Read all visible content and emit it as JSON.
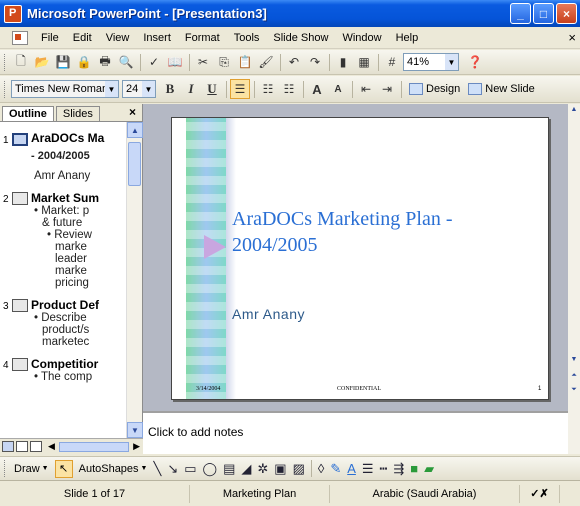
{
  "window": {
    "title": "Microsoft PowerPoint - [Presentation3]",
    "buttons": [
      "_",
      "□",
      "×"
    ]
  },
  "menu": {
    "items": [
      "File",
      "Edit",
      "View",
      "Insert",
      "Format",
      "Tools",
      "Slide Show",
      "Window",
      "Help"
    ],
    "close": "×"
  },
  "toolbar_standard": {
    "zoom": "41%"
  },
  "toolbar_formatting": {
    "font": "Times New Roman",
    "size": "24",
    "bold": "B",
    "italic": "I",
    "underline": "U",
    "grow_font": "A",
    "shrink_font": "A",
    "design": "Design",
    "new_slide": "New Slide"
  },
  "outline_pane": {
    "tabs": [
      "Outline",
      "Slides"
    ],
    "close": "×",
    "slides": [
      {
        "num": "1",
        "title": "AraDOCs Ma",
        "lines": [
          "- 2004/2005",
          "Amr Anany"
        ]
      },
      {
        "num": "2",
        "title": "Market Sum",
        "bullets": [
          "• Market: p",
          "& future",
          "• Review",
          "marke",
          "leader",
          "marke",
          "pricing"
        ]
      },
      {
        "num": "3",
        "title": "Product Def",
        "bullets": [
          "• Describe",
          "product/s",
          "marketec"
        ]
      },
      {
        "num": "4",
        "title": "Competitior",
        "bullets": [
          "• The comp"
        ]
      }
    ]
  },
  "slide": {
    "title": "AraDOCs Marketing Plan - 2004/2005",
    "subtitle": "Amr Anany",
    "footer_date": "3/14/2004",
    "footer_center": "CONFIDENTIAL",
    "footer_number": "1",
    "colors": {
      "title": "#2a6fd4",
      "subtitle": "#2d5a8a"
    }
  },
  "notes": {
    "placeholder": "Click to add notes"
  },
  "drawing_toolbar": {
    "draw": "Draw",
    "autoshapes": "AutoShapes"
  },
  "status": {
    "slide": "Slide 1 of 17",
    "design": "Marketing Plan",
    "language": "Arabic (Saudi Arabia)"
  }
}
